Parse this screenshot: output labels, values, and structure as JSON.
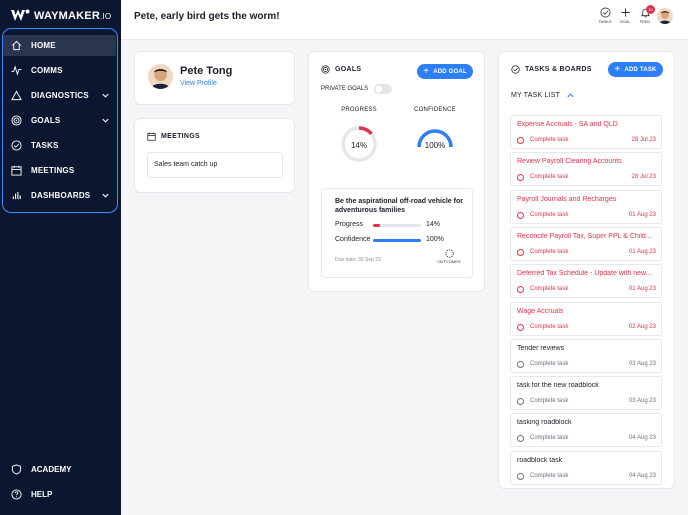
{
  "brand": {
    "name_bold": "WAYMAKER",
    "name_suffix": ".IO"
  },
  "colors": {
    "sidebar": "#0b1630",
    "accent": "#2d7ff9",
    "overdue": "#e0344a"
  },
  "sidebar": {
    "items": [
      {
        "label": "HOME",
        "icon": "home-icon",
        "active": true
      },
      {
        "label": "COMMS",
        "icon": "pulse-icon"
      },
      {
        "label": "DIAGNOSTICS",
        "icon": "triangle-icon",
        "expandable": true
      },
      {
        "label": "GOALS",
        "icon": "target-icon",
        "expandable": true
      },
      {
        "label": "TASKS",
        "icon": "check-circle-icon"
      },
      {
        "label": "MEETINGS",
        "icon": "calendar-icon"
      },
      {
        "label": "DASHBOARDS",
        "icon": "bar-chart-icon",
        "expandable": true
      }
    ],
    "bottom": [
      {
        "label": "ACADEMY",
        "icon": "shield-icon"
      },
      {
        "label": "HELP",
        "icon": "help-icon"
      }
    ]
  },
  "header": {
    "greeting": "Pete, early bird gets the worm!",
    "tasks_label": "TASKS",
    "goal_label": "GOAL",
    "feed_label": "FEED",
    "feed_count": "10"
  },
  "profile": {
    "name": "Pete Tong",
    "link": "View Profile"
  },
  "meetings": {
    "title": "MEETINGS",
    "items": [
      "Sales team catch up"
    ]
  },
  "goals": {
    "title": "GOALS",
    "add_label": "ADD GOAL",
    "private_label": "PRIVATE GOALS",
    "progress_label": "PROGRESS",
    "confidence_label": "CONFIDENCE",
    "progress_value": "14%",
    "confidence_value": "100%",
    "progress_pct": 14,
    "confidence_pct": 100,
    "goal": {
      "title": "Be the aspirational off-road vehicle for adventurous families",
      "progress_label": "Progress",
      "progress_value": "14%",
      "confidence_label": "Confidence",
      "confidence_value": "100%",
      "due": "Due date: 30 Sep 23",
      "outcomes_label": "OUTCOMES"
    }
  },
  "tasks": {
    "title": "TASKS & BOARDS",
    "add_label": "ADD TASK",
    "list_label": "MY TASK LIST",
    "complete_label": "Complete task",
    "items": [
      {
        "title": "Expense Accruals - SA and QLD",
        "date": "28 Jul 23",
        "overdue": true
      },
      {
        "title": "Review Payroll Clearing Accounts",
        "date": "28 Jul 23",
        "overdue": true
      },
      {
        "title": "Payroll Journals and Recharges",
        "date": "01 Aug 23",
        "overdue": true
      },
      {
        "title": "Reconcile Payroll Tax, Super PPL & Child...",
        "date": "01 Aug 23",
        "overdue": true
      },
      {
        "title": "Deferred Tax Schedule - Update with new...",
        "date": "01 Aug 23",
        "overdue": true
      },
      {
        "title": "Wage Accruals",
        "date": "02 Aug 23",
        "overdue": true
      },
      {
        "title": "Tender reviews",
        "date": "03 Aug 23",
        "overdue": false
      },
      {
        "title": "task for the new roadblock",
        "date": "03 Aug 23",
        "overdue": false
      },
      {
        "title": "tasking roadblock",
        "date": "04 Aug 23",
        "overdue": false
      },
      {
        "title": "roadblock task",
        "date": "04 Aug 23",
        "overdue": false
      }
    ]
  }
}
